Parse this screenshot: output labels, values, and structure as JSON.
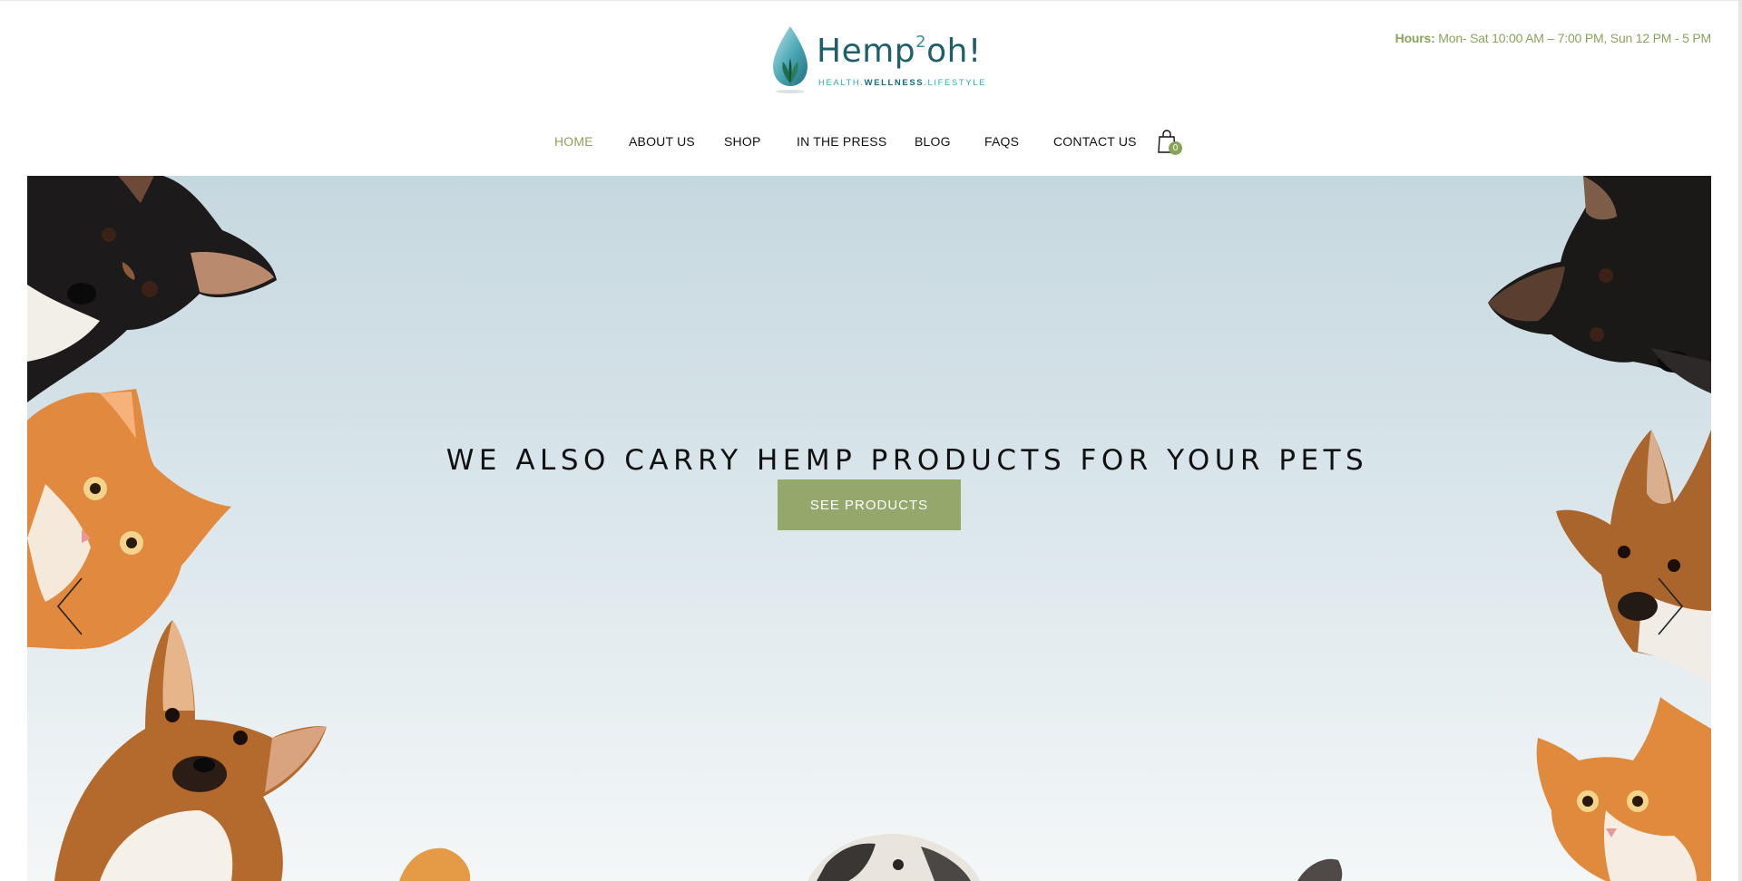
{
  "header": {
    "hours_label": "Hours:",
    "hours_text": " Mon- Sat 10:00 AM – 7:00 PM, Sun 12 PM - 5 PM",
    "logo": {
      "word": "Hemp",
      "superscript": "2",
      "word_end": "oh!",
      "tagline_part1": "HEALTH.",
      "tagline_part2": "WELLNESS",
      "tagline_part3": ".LIFESTYLE"
    }
  },
  "nav": {
    "items": [
      {
        "label": "HOME",
        "active": true
      },
      {
        "label": "ABOUT US",
        "active": false
      },
      {
        "label": "SHOP",
        "active": false
      },
      {
        "label": "IN THE PRESS",
        "active": false
      },
      {
        "label": "BLOG",
        "active": false
      },
      {
        "label": "FAQS",
        "active": false
      },
      {
        "label": "CONTACT US",
        "active": false
      }
    ],
    "cart_count": "0",
    "cart_icon": "shopping-bag-icon"
  },
  "hero": {
    "headline": "WE ALSO CARRY HEMP PRODUCTS FOR YOUR PETS",
    "button_label": "SEE PRODUCTS",
    "prev_icon": "chevron-left-icon",
    "next_icon": "chevron-right-icon"
  },
  "colors": {
    "accent": "#8aa35a",
    "button": "#93a86a",
    "logo_teal": "#1f5f6a"
  }
}
